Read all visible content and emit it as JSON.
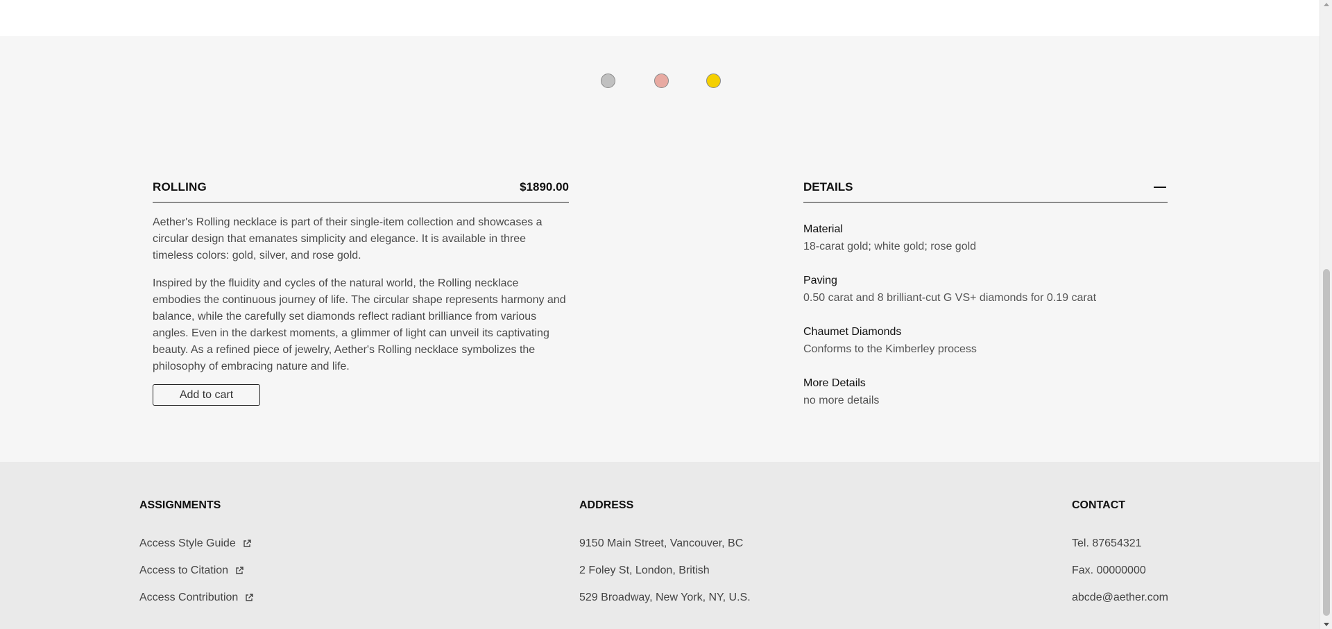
{
  "color_swatches": [
    {
      "name": "silver",
      "color": "#c0c0c0"
    },
    {
      "name": "rose-gold",
      "color": "#e8aaa2"
    },
    {
      "name": "gold",
      "color": "#f5d000"
    }
  ],
  "product": {
    "name": "ROLLING",
    "price": "$1890.00",
    "description_1": "Aether's Rolling necklace is part of their single-item collection and showcases a circular design that emanates simplicity and elegance. It is available in three timeless colors: gold, silver, and rose gold.",
    "description_2": "Inspired by the fluidity and cycles of the natural world, the Rolling necklace embodies the continuous journey of life. The circular shape represents harmony and balance, while the carefully set diamonds reflect radiant brilliance from various angles. Even in the darkest moments, a glimmer of light can unveil its captivating beauty. As a refined piece of jewelry, Aether's Rolling necklace symbolizes the philosophy of embracing nature and life.",
    "add_to_cart_label": "Add to cart"
  },
  "details": {
    "title": "DETAILS",
    "items": [
      {
        "label": "Material",
        "value": "18-carat gold; white gold; rose gold"
      },
      {
        "label": "Paving",
        "value": "0.50 carat and 8 brilliant-cut G VS+ diamonds for 0.19 carat"
      },
      {
        "label": "Chaumet Diamonds",
        "value": "Conforms to the Kimberley process"
      },
      {
        "label": "More Details",
        "value": "no more details"
      }
    ]
  },
  "footer": {
    "assignments": {
      "title": "ASSIGNMENTS",
      "links": [
        "Access Style Guide",
        "Access to Citation",
        "Access Contribution"
      ]
    },
    "address": {
      "title": "ADDRESS",
      "lines": [
        "9150 Main Street, Vancouver, BC",
        "2 Foley St, London, British",
        "529 Broadway, New York, NY, U.S."
      ]
    },
    "contact": {
      "title": "CONTACT",
      "lines": [
        "Tel. 87654321",
        "Fax. 00000000",
        "abcde@aether.com"
      ]
    }
  }
}
